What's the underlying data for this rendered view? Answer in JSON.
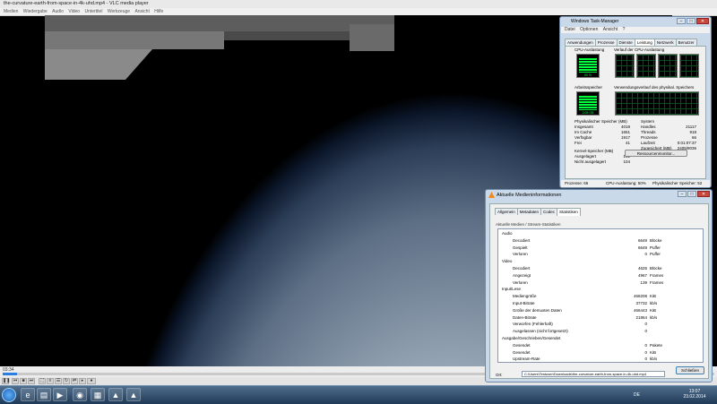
{
  "vlc": {
    "title": "the-curvature-earth-from-space-in-4k-uhd.mp4 - VLC media player",
    "menu": [
      "Medien",
      "Wiedergabe",
      "Audio",
      "Video",
      "Untertitel",
      "Werkzeuge",
      "Ansicht",
      "Hilfe"
    ],
    "time_elapsed": "03:34",
    "progress": 0.02
  },
  "taskmgr": {
    "title": "Windows Task-Manager",
    "menu": [
      "Datei",
      "Optionen",
      "Ansicht",
      "?"
    ],
    "tabs": [
      "Anwendungen",
      "Prozesse",
      "Dienste",
      "Leistung",
      "Netzwerk",
      "Benutzer"
    ],
    "active_tab": "Leistung",
    "cpu_label": "CPU-Auslastung",
    "cpu_value": "50 %",
    "cpu_history_label": "Verlauf der CPU-Auslastung",
    "mem_label": "Arbeitsspeicher",
    "mem_value": "2,05 GB",
    "mem_history_label": "Verwendungsverlauf des physikal. Speichers",
    "phys_title": "Physikalischer Speicher (MB)",
    "phys": [
      {
        "k": "Insgesamt",
        "v": "4019"
      },
      {
        "k": "Im Cache",
        "v": "1651"
      },
      {
        "k": "Verfügbar",
        "v": "1917"
      },
      {
        "k": "Frei",
        "v": "41"
      }
    ],
    "kernel_title": "Kernel-Speicher (MB)",
    "kernel": [
      {
        "k": "Ausgelagert",
        "v": "141"
      },
      {
        "k": "Nicht ausgelagert",
        "v": "104"
      }
    ],
    "system_title": "System",
    "system": [
      {
        "k": "Handles",
        "v": "21117"
      },
      {
        "k": "Threads",
        "v": "918"
      },
      {
        "k": "Prozesse",
        "v": "66"
      },
      {
        "k": "Laufzeit",
        "v": "0:01:07:37"
      },
      {
        "k": "Zugesichert (MB)",
        "v": "2405/8036"
      }
    ],
    "resmon_button": "Ressourcenmonitor...",
    "status_processes": "Prozesse: 66",
    "status_cpu": "CPU-Auslastung: 50%",
    "status_mem": "Physikalischer Speicher: 52"
  },
  "mediainfo": {
    "title": "Aktuelle Medieninformationen",
    "tabs": [
      "Allgemein",
      "Metadaten",
      "Codec",
      "Statistiken"
    ],
    "active_tab": "Statistiken",
    "section": "Aktuelle Medien / Stream-Statistiken",
    "rows": [
      {
        "label": "Audio",
        "value": "",
        "unit": "",
        "level": 0
      },
      {
        "label": "Decodiert",
        "value": "6649",
        "unit": "Blöcke",
        "level": 1
      },
      {
        "label": "Gespielt",
        "value": "6649",
        "unit": "Puffer",
        "level": 1
      },
      {
        "label": "Verloren",
        "value": "0",
        "unit": "Puffer",
        "level": 1
      },
      {
        "label": "Video",
        "value": "",
        "unit": "",
        "level": 0
      },
      {
        "label": "Decodiert",
        "value": "4625",
        "unit": "Blöcke",
        "level": 1
      },
      {
        "label": "Angezeigt",
        "value": "4967",
        "unit": "Frames",
        "level": 1
      },
      {
        "label": "Verloren",
        "value": "139",
        "unit": "Frames",
        "level": 1
      },
      {
        "label": "Input/Lese",
        "value": "",
        "unit": "",
        "level": 0
      },
      {
        "label": "Mediengröße",
        "value": "468208",
        "unit": "KiB",
        "level": 1
      },
      {
        "label": "Input-Bitrate",
        "value": "37732",
        "unit": "kb/s",
        "level": 1
      },
      {
        "label": "Größe der demuxten Daten",
        "value": "466443",
        "unit": "KiB",
        "level": 1
      },
      {
        "label": "Daten-Bitrate",
        "value": "21864",
        "unit": "kb/s",
        "level": 1
      },
      {
        "label": "Verworfen (Fehlerhaft)",
        "value": "0",
        "unit": "",
        "level": 1
      },
      {
        "label": "Ausgelassen (nicht fortgesetzt)",
        "value": "0",
        "unit": "",
        "level": 1
      },
      {
        "label": "Ausgabe/Geschrieben/Gesendet",
        "value": "",
        "unit": "",
        "level": 0
      },
      {
        "label": "Gesendet",
        "value": "0",
        "unit": "Pakete",
        "level": 1
      },
      {
        "label": "Gesendet",
        "value": "0",
        "unit": "KiB",
        "level": 1
      },
      {
        "label": "Upstream-Rate",
        "value": "0",
        "unit": "kb/s",
        "level": 1
      }
    ],
    "location_label": "Ort:",
    "location_value": "C:\\Users\\Testuser\\Downloads\\the-curvature-earth-from-space-in-4k-uhd.mp4",
    "close_button": "Schließen"
  },
  "taskbar": {
    "language": "DE",
    "time": "13:07",
    "date": "23.02.2014"
  }
}
